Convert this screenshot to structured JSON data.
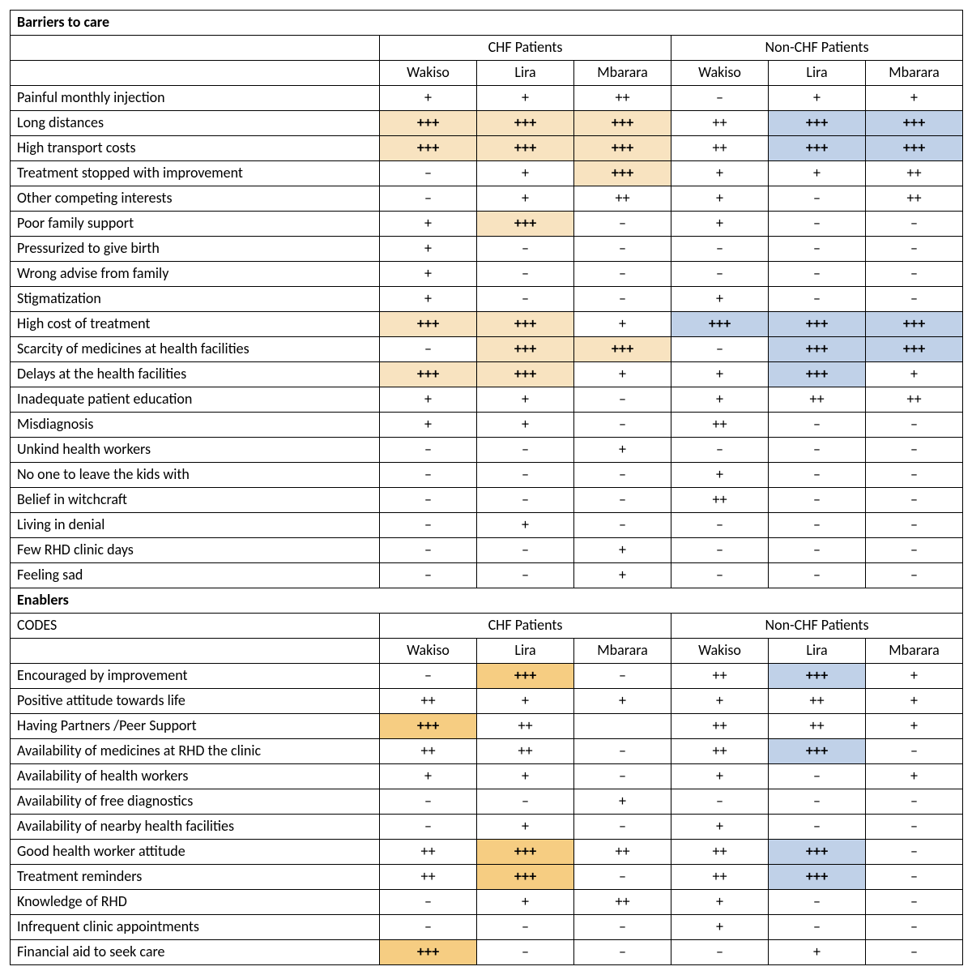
{
  "groups": {
    "chf": "CHF Patients",
    "nonchf": "Non-CHF Patients"
  },
  "columns": [
    "Wakiso",
    "Lira",
    "Mbarara",
    "Wakiso",
    "Lira",
    "Mbarara"
  ],
  "sections": [
    {
      "title": "Barriers to care",
      "codes_label": "",
      "rows": [
        {
          "label": "Painful monthly injection",
          "cells": [
            {
              "v": "+"
            },
            {
              "v": "+"
            },
            {
              "v": "++"
            },
            {
              "v": "–"
            },
            {
              "v": "+"
            },
            {
              "v": "+"
            }
          ]
        },
        {
          "label": "Long distances",
          "cells": [
            {
              "v": "+++",
              "b": true,
              "hl": "tanL"
            },
            {
              "v": "+++",
              "b": true,
              "hl": "tanL"
            },
            {
              "v": "+++",
              "b": true,
              "hl": "tanL"
            },
            {
              "v": "++"
            },
            {
              "v": "+++",
              "b": true,
              "hl": "blue"
            },
            {
              "v": "+++",
              "b": true,
              "hl": "blue"
            }
          ]
        },
        {
          "label": "High transport costs",
          "cells": [
            {
              "v": "+++",
              "b": true,
              "hl": "tanL"
            },
            {
              "v": "+++",
              "b": true,
              "hl": "tanL"
            },
            {
              "v": "+++",
              "b": true,
              "hl": "tanL"
            },
            {
              "v": "++"
            },
            {
              "v": "+++",
              "b": true,
              "hl": "blue"
            },
            {
              "v": "+++",
              "b": true,
              "hl": "blue"
            }
          ]
        },
        {
          "label": "Treatment stopped with improvement",
          "cells": [
            {
              "v": "–"
            },
            {
              "v": "+"
            },
            {
              "v": "+++",
              "b": true,
              "hl": "tanL"
            },
            {
              "v": "+"
            },
            {
              "v": "+"
            },
            {
              "v": "++"
            }
          ]
        },
        {
          "label": "Other competing interests",
          "cells": [
            {
              "v": "–"
            },
            {
              "v": "+"
            },
            {
              "v": "++"
            },
            {
              "v": "+"
            },
            {
              "v": "–"
            },
            {
              "v": "++"
            }
          ]
        },
        {
          "label": "Poor family support",
          "cells": [
            {
              "v": "+"
            },
            {
              "v": "+++",
              "b": true,
              "hl": "tanL"
            },
            {
              "v": "–"
            },
            {
              "v": "+"
            },
            {
              "v": "–"
            },
            {
              "v": "–"
            }
          ]
        },
        {
          "label": "Pressurized to give birth",
          "cells": [
            {
              "v": "+"
            },
            {
              "v": "–"
            },
            {
              "v": "–"
            },
            {
              "v": "–"
            },
            {
              "v": "–"
            },
            {
              "v": "–"
            }
          ]
        },
        {
          "label": "Wrong advise from family",
          "cells": [
            {
              "v": "+"
            },
            {
              "v": "–"
            },
            {
              "v": "–"
            },
            {
              "v": "–"
            },
            {
              "v": "–"
            },
            {
              "v": "–"
            }
          ]
        },
        {
          "label": "Stigmatization",
          "cells": [
            {
              "v": "+"
            },
            {
              "v": "–"
            },
            {
              "v": "–"
            },
            {
              "v": "+"
            },
            {
              "v": "–"
            },
            {
              "v": "–"
            }
          ]
        },
        {
          "label": "High cost of treatment",
          "cells": [
            {
              "v": "+++",
              "b": true,
              "hl": "tanL"
            },
            {
              "v": "+++",
              "b": true,
              "hl": "tanL"
            },
            {
              "v": "+"
            },
            {
              "v": "+++",
              "b": true,
              "hl": "blue"
            },
            {
              "v": "+++",
              "b": true,
              "hl": "blue"
            },
            {
              "v": "+++",
              "b": true,
              "hl": "blue"
            }
          ]
        },
        {
          "label": "Scarcity of medicines at health facilities",
          "cells": [
            {
              "v": "–"
            },
            {
              "v": "+++",
              "b": true,
              "hl": "tanL"
            },
            {
              "v": "+++",
              "b": true,
              "hl": "tanL"
            },
            {
              "v": "–"
            },
            {
              "v": "+++",
              "b": true,
              "hl": "blue"
            },
            {
              "v": "+++",
              "b": true,
              "hl": "blue"
            }
          ]
        },
        {
          "label": "Delays at the health facilities",
          "cells": [
            {
              "v": "+++",
              "b": true,
              "hl": "tanL"
            },
            {
              "v": "+++",
              "b": true,
              "hl": "tanL"
            },
            {
              "v": "+"
            },
            {
              "v": "+"
            },
            {
              "v": "+++",
              "b": true,
              "hl": "blue"
            },
            {
              "v": "+"
            }
          ]
        },
        {
          "label": "Inadequate patient education",
          "cells": [
            {
              "v": "+"
            },
            {
              "v": "+"
            },
            {
              "v": "–"
            },
            {
              "v": "+"
            },
            {
              "v": "++"
            },
            {
              "v": "++"
            }
          ]
        },
        {
          "label": "Misdiagnosis",
          "cells": [
            {
              "v": "+"
            },
            {
              "v": "+"
            },
            {
              "v": "–"
            },
            {
              "v": "++"
            },
            {
              "v": "–"
            },
            {
              "v": "–"
            }
          ]
        },
        {
          "label": "Unkind health workers",
          "cells": [
            {
              "v": "–"
            },
            {
              "v": "–"
            },
            {
              "v": "+"
            },
            {
              "v": "–"
            },
            {
              "v": "–"
            },
            {
              "v": "–"
            }
          ]
        },
        {
          "label": "No one to leave the kids with",
          "cells": [
            {
              "v": "–"
            },
            {
              "v": "–"
            },
            {
              "v": "–"
            },
            {
              "v": "+"
            },
            {
              "v": "–"
            },
            {
              "v": "–"
            }
          ]
        },
        {
          "label": "Belief in witchcraft",
          "cells": [
            {
              "v": "–"
            },
            {
              "v": "–"
            },
            {
              "v": "–"
            },
            {
              "v": "++"
            },
            {
              "v": "–"
            },
            {
              "v": "–"
            }
          ]
        },
        {
          "label": "Living in denial",
          "cells": [
            {
              "v": "–"
            },
            {
              "v": "+"
            },
            {
              "v": "–"
            },
            {
              "v": "–"
            },
            {
              "v": "–"
            },
            {
              "v": "–"
            }
          ]
        },
        {
          "label": "Few RHD clinic days",
          "cells": [
            {
              "v": "–"
            },
            {
              "v": "–"
            },
            {
              "v": "+"
            },
            {
              "v": "–"
            },
            {
              "v": "–"
            },
            {
              "v": "–"
            }
          ]
        },
        {
          "label": "Feeling sad",
          "cells": [
            {
              "v": "–"
            },
            {
              "v": "–"
            },
            {
              "v": "+"
            },
            {
              "v": "–"
            },
            {
              "v": "–"
            },
            {
              "v": "–"
            }
          ]
        }
      ]
    },
    {
      "title": "Enablers",
      "codes_label": "CODES",
      "rows": [
        {
          "label": "Encouraged by improvement",
          "cells": [
            {
              "v": "–"
            },
            {
              "v": "+++",
              "b": true,
              "hl": "tan"
            },
            {
              "v": "–"
            },
            {
              "v": "++"
            },
            {
              "v": "+++",
              "b": true,
              "hl": "blue"
            },
            {
              "v": "+"
            }
          ]
        },
        {
          "label": "Positive attitude towards life",
          "cells": [
            {
              "v": "++"
            },
            {
              "v": "+"
            },
            {
              "v": "+"
            },
            {
              "v": "+"
            },
            {
              "v": "++"
            },
            {
              "v": "+"
            }
          ]
        },
        {
          "label": "Having Partners /Peer Support",
          "cells": [
            {
              "v": "+++",
              "b": true,
              "hl": "tan"
            },
            {
              "v": "++"
            },
            {
              "v": ""
            },
            {
              "v": "++"
            },
            {
              "v": "++"
            },
            {
              "v": "+"
            }
          ]
        },
        {
          "label": "Availability of medicines at RHD the clinic",
          "cells": [
            {
              "v": "++"
            },
            {
              "v": "++"
            },
            {
              "v": "–"
            },
            {
              "v": "++"
            },
            {
              "v": "+++",
              "b": true,
              "hl": "blue"
            },
            {
              "v": "–"
            }
          ]
        },
        {
          "label": "Availability of health workers",
          "cells": [
            {
              "v": "+"
            },
            {
              "v": "+"
            },
            {
              "v": "–"
            },
            {
              "v": "+"
            },
            {
              "v": "–"
            },
            {
              "v": "+"
            }
          ]
        },
        {
          "label": "Availability of free diagnostics",
          "cells": [
            {
              "v": "–"
            },
            {
              "v": "–"
            },
            {
              "v": "+"
            },
            {
              "v": "–"
            },
            {
              "v": "–"
            },
            {
              "v": "–"
            }
          ]
        },
        {
          "label": "Availability of nearby health facilities",
          "cells": [
            {
              "v": "–"
            },
            {
              "v": "+"
            },
            {
              "v": "–"
            },
            {
              "v": "+"
            },
            {
              "v": "–"
            },
            {
              "v": "–"
            }
          ]
        },
        {
          "label": "Good health worker attitude",
          "cells": [
            {
              "v": "++"
            },
            {
              "v": "+++",
              "b": true,
              "hl": "tan"
            },
            {
              "v": "++"
            },
            {
              "v": "++"
            },
            {
              "v": "+++",
              "b": true,
              "hl": "blue"
            },
            {
              "v": "–"
            }
          ]
        },
        {
          "label": "Treatment reminders",
          "cells": [
            {
              "v": "++"
            },
            {
              "v": "+++",
              "b": true,
              "hl": "tan"
            },
            {
              "v": "–"
            },
            {
              "v": "++"
            },
            {
              "v": "+++",
              "b": true,
              "hl": "blue"
            },
            {
              "v": "–"
            }
          ]
        },
        {
          "label": "Knowledge of RHD",
          "cells": [
            {
              "v": "–"
            },
            {
              "v": "+"
            },
            {
              "v": "++"
            },
            {
              "v": "+"
            },
            {
              "v": "–"
            },
            {
              "v": "–"
            }
          ]
        },
        {
          "label": "Infrequent clinic appointments",
          "cells": [
            {
              "v": "–"
            },
            {
              "v": "–"
            },
            {
              "v": "–"
            },
            {
              "v": "+"
            },
            {
              "v": "–"
            },
            {
              "v": "–"
            }
          ]
        },
        {
          "label": "Financial aid to seek care",
          "cells": [
            {
              "v": "+++",
              "b": true,
              "hl": "tan"
            },
            {
              "v": "–"
            },
            {
              "v": "–"
            },
            {
              "v": "–"
            },
            {
              "v": "+"
            },
            {
              "v": "–"
            }
          ]
        }
      ]
    }
  ]
}
